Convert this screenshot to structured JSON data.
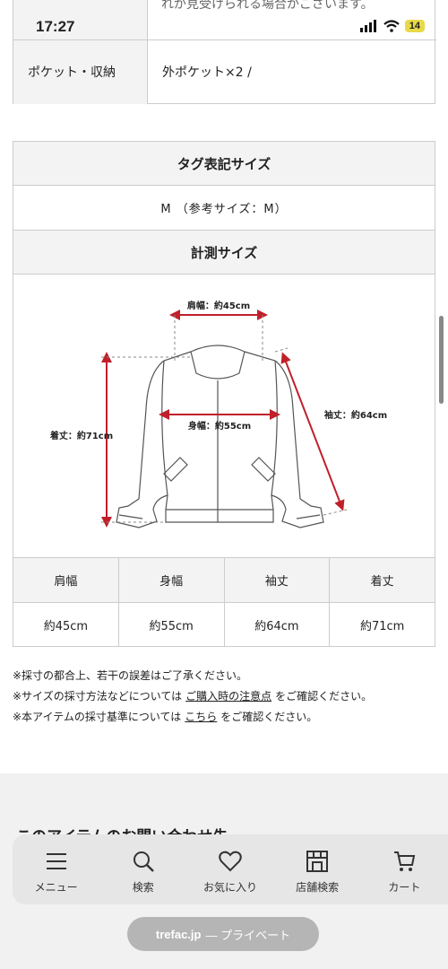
{
  "status": {
    "time": "17:27",
    "battery": "14"
  },
  "clipped_text": "れが見受けられる場合がございます。",
  "spec": {
    "label": "ポケット・収納",
    "value": "外ポケット×2 /"
  },
  "size": {
    "tag_heading": "タグ表記サイズ",
    "tag_value": "M （参考サイズ：M）",
    "measure_heading": "計測サイズ",
    "diagram_labels": {
      "shoulder": "肩幅：約45cm",
      "body": "身幅：約55cm",
      "sleeve": "袖丈：約64cm",
      "length": "着丈：約71cm"
    },
    "columns": [
      {
        "header": "肩幅",
        "value": "約45cm"
      },
      {
        "header": "身幅",
        "value": "約55cm"
      },
      {
        "header": "袖丈",
        "value": "約64cm"
      },
      {
        "header": "着丈",
        "value": "約71cm"
      }
    ]
  },
  "notes": {
    "line1": "※採寸の都合上、若干の誤差はご了承ください。",
    "line2_pre": "※サイズの採寸方法などについては",
    "line2_link": "ご購入時の注意点",
    "line2_post": "をご確認ください。",
    "line3_pre": "※本アイテムの採寸基準については",
    "line3_link": "こちら",
    "line3_post": "をご確認ください。"
  },
  "partial_heading": "このアイテムのお問い合わせ先",
  "tabs": [
    {
      "label": "メニュー",
      "icon": "menu-icon"
    },
    {
      "label": "検索",
      "icon": "search-icon"
    },
    {
      "label": "お気に入り",
      "icon": "heart-icon"
    },
    {
      "label": "店舗検索",
      "icon": "store-icon"
    },
    {
      "label": "カート",
      "icon": "cart-icon"
    }
  ],
  "url_bar": {
    "domain": "trefac.jp",
    "suffix": "— プライベート"
  },
  "colors": {
    "measure_red": "#c0202a",
    "header_bg": "#f3f3f3",
    "border": "#cccccc"
  }
}
